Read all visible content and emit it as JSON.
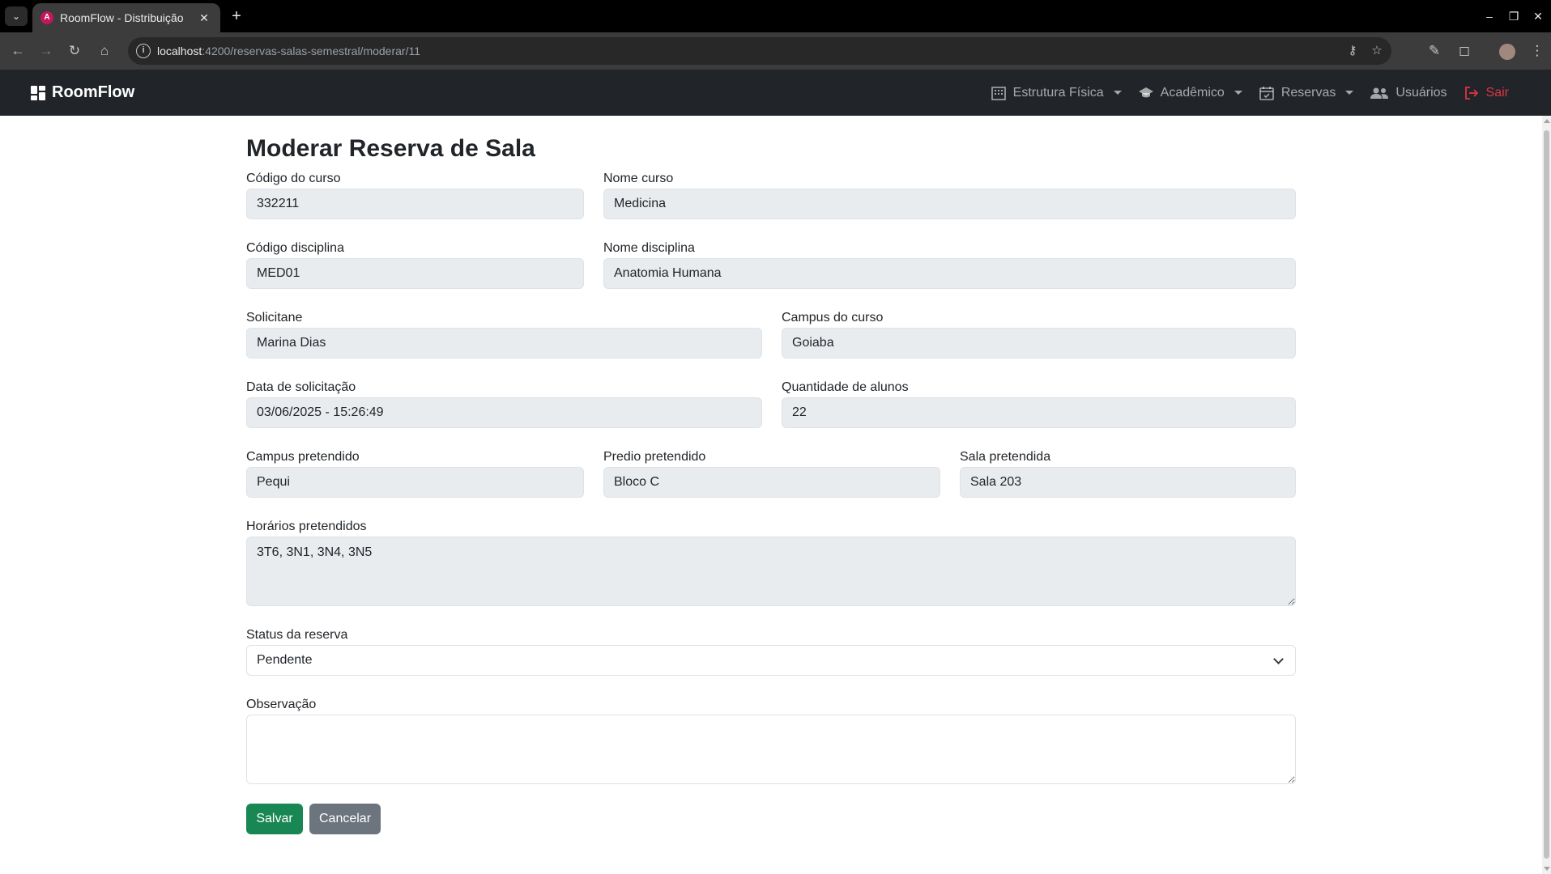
{
  "browser": {
    "tab_title": "RoomFlow - Distribuição",
    "url_host": "localhost",
    "url_path": ":4200/reservas-salas-semestral/moderar/11"
  },
  "navbar": {
    "brand": "RoomFlow",
    "items": [
      {
        "label": "Estrutura Física",
        "icon": "building-icon",
        "dropdown": true
      },
      {
        "label": "Acadêmico",
        "icon": "graduation-cap-icon",
        "dropdown": true
      },
      {
        "label": "Reservas",
        "icon": "calendar-check-icon",
        "dropdown": true
      },
      {
        "label": "Usuários",
        "icon": "users-icon",
        "dropdown": false
      },
      {
        "label": "Sair",
        "icon": "logout-icon",
        "dropdown": false
      }
    ]
  },
  "form": {
    "title": "Moderar Reserva de Sala",
    "codigo_curso": {
      "label": "Código do curso",
      "value": "332211"
    },
    "nome_curso": {
      "label": "Nome curso",
      "value": "Medicina"
    },
    "codigo_disciplina": {
      "label": "Código disciplina",
      "value": "MED01"
    },
    "nome_disciplina": {
      "label": "Nome disciplina",
      "value": "Anatomia Humana"
    },
    "solicitante": {
      "label": "Solicitane",
      "value": "Marina Dias"
    },
    "campus_curso": {
      "label": "Campus do curso",
      "value": "Goiaba"
    },
    "data_solicitacao": {
      "label": "Data de solicitação",
      "value": "03/06/2025 - 15:26:49"
    },
    "quantidade_alunos": {
      "label": "Quantidade de alunos",
      "value": "22"
    },
    "campus_pretendido": {
      "label": "Campus pretendido",
      "value": "Pequi"
    },
    "predio_pretendido": {
      "label": "Predio pretendido",
      "value": "Bloco C"
    },
    "sala_pretendida": {
      "label": "Sala pretendida",
      "value": "Sala 203"
    },
    "horarios": {
      "label": "Horários pretendidos",
      "value": "3T6, 3N1, 3N4, 3N5"
    },
    "status": {
      "label": "Status da reserva",
      "value": "Pendente"
    },
    "observacao": {
      "label": "Observação",
      "value": ""
    },
    "save_label": "Salvar",
    "cancel_label": "Cancelar"
  },
  "colors": {
    "navbar_bg": "#212529",
    "save": "#198754",
    "cancel": "#6c757d",
    "logout": "#dc3545",
    "readonly_bg": "#e9ecef"
  }
}
